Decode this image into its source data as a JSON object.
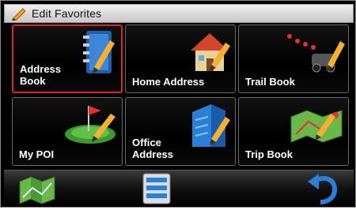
{
  "window": {
    "title": "Edit Favorites"
  },
  "tiles": [
    {
      "label": "Address\nBook"
    },
    {
      "label": "Home Address"
    },
    {
      "label": "Trail Book"
    },
    {
      "label": "My POI"
    },
    {
      "label": "Office\nAddress"
    },
    {
      "label": "Trip Book"
    }
  ],
  "icons": {
    "title": "pencil-icon",
    "address_book": "address-book-icon",
    "home_address": "house-icon",
    "trail_book": "trail-icon",
    "my_poi": "poi-flag-icon",
    "office_address": "office-building-icon",
    "trip_book": "trip-map-icon",
    "map": "map-icon",
    "list": "list-icon",
    "back": "back-arrow-icon"
  },
  "colors": {
    "selected_border": "#e1202a",
    "accent_blue": "#2c7fd6"
  }
}
